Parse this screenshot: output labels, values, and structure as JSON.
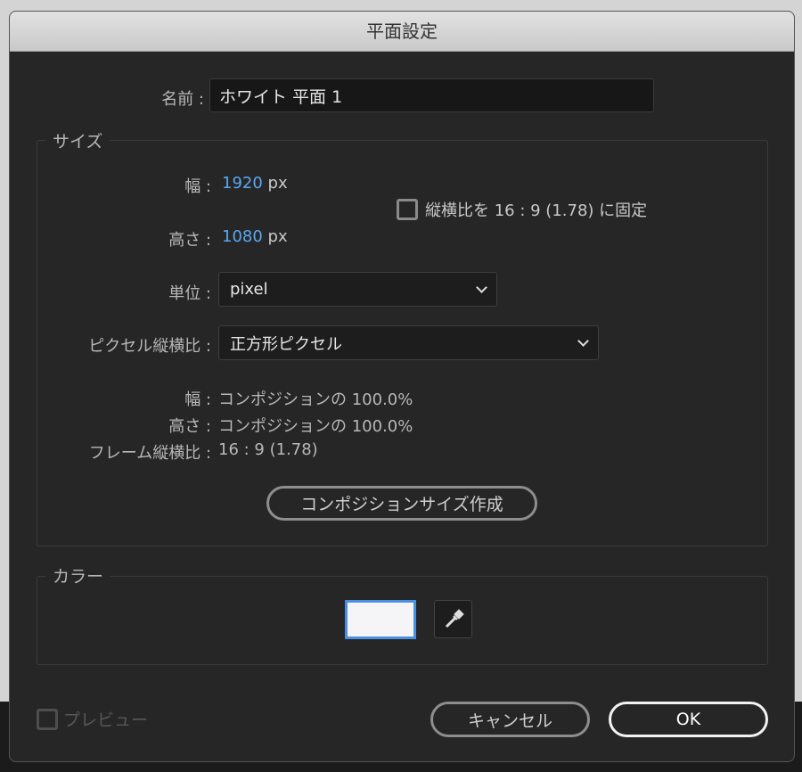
{
  "title": "平面設定",
  "name": {
    "label": "名前 :",
    "value": "ホワイト 平面 1"
  },
  "size": {
    "group_title": "サイズ",
    "width_label": "幅 :",
    "width_value": "1920",
    "width_unit": "px",
    "height_label": "高さ :",
    "height_value": "1080",
    "height_unit": "px",
    "lock_aspect_label": "縦横比を 16 : 9 (1.78) に固定",
    "lock_aspect_checked": false,
    "unit_label": "単位 :",
    "unit_value": "pixel",
    "pixel_aspect_label": "ピクセル縦横比 :",
    "pixel_aspect_value": "正方形ピクセル",
    "info_width_label": "幅 :",
    "info_width_value": "コンポジションの 100.0%",
    "info_height_label": "高さ :",
    "info_height_value": "コンポジションの 100.0%",
    "frame_aspect_label": "フレーム縦横比 :",
    "frame_aspect_value": "16 : 9 (1.78)",
    "make_comp_size": "コンポジションサイズ作成"
  },
  "color": {
    "group_title": "カラー",
    "swatch": "#f5f5f7",
    "accent": "#4a90e2"
  },
  "footer": {
    "preview_label": "プレビュー",
    "cancel": "キャンセル",
    "ok": "OK"
  }
}
